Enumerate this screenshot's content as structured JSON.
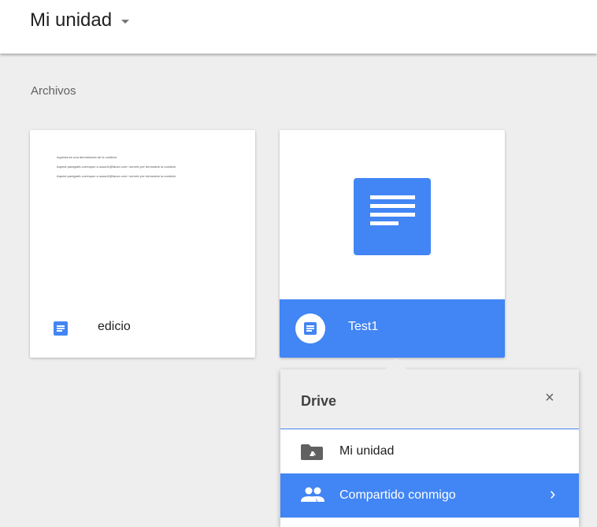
{
  "header": {
    "title": "Mi unidad"
  },
  "section": {
    "label": "Archivos"
  },
  "files": [
    {
      "name": "edicio",
      "preview_lines": [
        "Aquesta és una demostració de la coedició",
        "Aquest paràgrafs correspon a usuari1@fauxx.com i serveix per demostrar la coedició",
        "Aquest paràgrafs correspon a usuari2@fauxx.com i serveix per demostrar la coedició"
      ]
    },
    {
      "name": "Test1"
    }
  ],
  "popup": {
    "title": "Drive",
    "close_glyph": "×",
    "items": [
      {
        "label": "Mi unidad"
      },
      {
        "label": "Compartido conmigo",
        "chevron": "›"
      }
    ]
  },
  "colors": {
    "accent": "#4285f4",
    "background": "#eeeeee"
  }
}
